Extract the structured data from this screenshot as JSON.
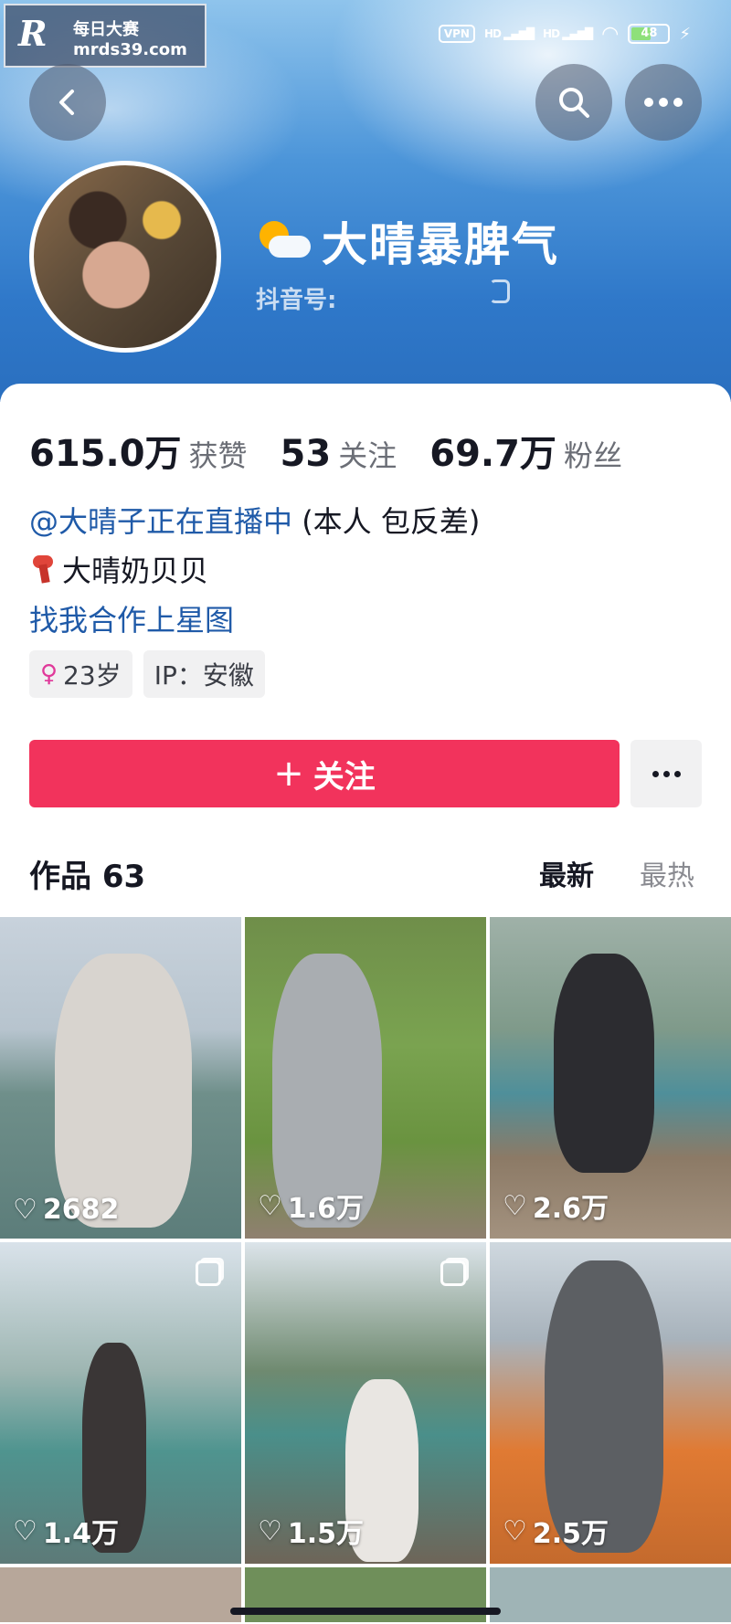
{
  "watermark": {
    "logo": "R",
    "top": "每日大赛",
    "url": "mrds39.com"
  },
  "status_bar": {
    "vpn": "VPN",
    "signal1": "HD",
    "signal2": "HD",
    "battery": "48"
  },
  "profile": {
    "name": "大晴暴脾气",
    "douyin_id_label": "抖音号:"
  },
  "stats": [
    {
      "num": "615.0万",
      "label": "获赞"
    },
    {
      "num": "53",
      "label": "关注"
    },
    {
      "num": "69.7万",
      "label": "粉丝"
    }
  ],
  "bio": {
    "mention": "@大晴子正在直播中",
    "mention_rest": " (本人 包反差)",
    "line2": "大晴奶贝贝",
    "line3": "找我合作上星图"
  },
  "tags": {
    "age": "23岁",
    "ip": "IP：安徽"
  },
  "follow": {
    "label": "关注",
    "plus": "+"
  },
  "works": {
    "title": "作品 63",
    "sort_new": "最新",
    "sort_hot": "最热"
  },
  "videos": [
    {
      "likes": "2682"
    },
    {
      "likes": "1.6万"
    },
    {
      "likes": "2.6万"
    },
    {
      "likes": "1.4万"
    },
    {
      "likes": "1.5万"
    },
    {
      "likes": "2.5万"
    }
  ]
}
